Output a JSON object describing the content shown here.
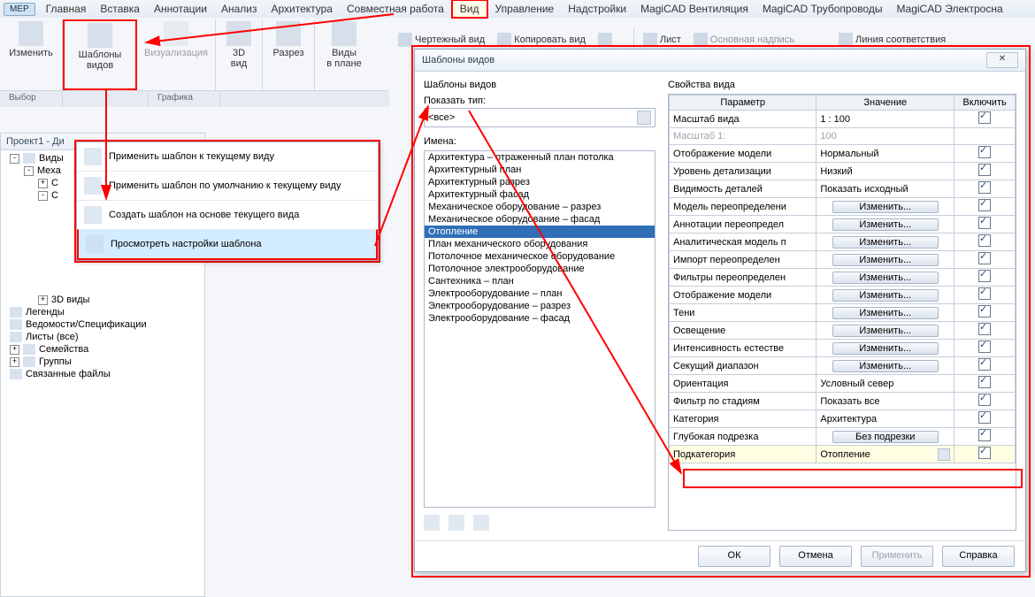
{
  "menu": {
    "mep": "МЕР",
    "items": [
      "Главная",
      "Вставка",
      "Аннотации",
      "Анализ",
      "Архитектура",
      "Совместная работа",
      "Вид",
      "Управление",
      "Надстройки",
      "MagiCAD Вентиляция",
      "MagiCAD Трубопроводы",
      "MagiCAD Электросна"
    ],
    "active": "Вид"
  },
  "subribbon": {
    "draftView": "Чертежный вид",
    "copyView": "Копировать вид",
    "sheet": "Лист",
    "titleBlock": "Основная надпись",
    "matchLine": "Линия соответствия"
  },
  "ribbon": {
    "edit": "Изменить",
    "templates": "Шаблоны\nвидов",
    "viz": "Визуализация",
    "view3d": "3D\nвид",
    "section": "Разрез",
    "planViews": "Виды\nв плане",
    "panelSelect": "Выбор",
    "panelGraphics": "Графика"
  },
  "browser": {
    "title": "Проект1 - Ди",
    "nodes": {
      "views": "Виды",
      "mech": "Mexa",
      "c": "С",
      "views3d": "3D виды",
      "legends": "Легенды",
      "schedules": "Ведомости/Спецификации",
      "sheets": "Листы (все)",
      "families": "Семейства",
      "groups": "Группы",
      "links": "Связанные файлы"
    }
  },
  "ctx": {
    "apply": "Применить шаблон к текущему виду",
    "applyDefault": "Применить шаблон по умолчанию к текущему виду",
    "create": "Создать шаблон на основе текущего вида",
    "view": "Просмотреть настройки шаблона"
  },
  "dlg": {
    "title": "Шаблоны видов",
    "left": {
      "heading": "Шаблоны видов",
      "showType": "Показать тип:",
      "all": "<все>",
      "names": "Имена:",
      "items": [
        "Архитектура – отраженный план потолка",
        "Архитектурный план",
        "Архитектурный разрез",
        "Архитектурный фасад",
        "Механическое оборудование – разрез",
        "Механическое оборудование – фасад",
        "Отопление",
        "План механического оборудования",
        "Потолочное механическое оборудование",
        "Потолочное электрооборудование",
        "Сантехника – план",
        "Электрооборудование – план",
        "Электрооборудование – разрез",
        "Электрооборудование – фасад"
      ],
      "selected": "Отопление"
    },
    "right": {
      "heading": "Свойства вида",
      "cols": {
        "param": "Параметр",
        "value": "Значение",
        "include": "Включить"
      },
      "rows": [
        {
          "p": "Масштаб вида",
          "v": "1 : 100",
          "btn": false,
          "inc": true
        },
        {
          "p": "Масштаб  1:",
          "v": "100",
          "btn": false,
          "inc": false,
          "dim": true
        },
        {
          "p": "Отображение модели",
          "v": "Нормальный",
          "btn": false,
          "inc": true
        },
        {
          "p": "Уровень детализации",
          "v": "Низкий",
          "btn": false,
          "inc": true
        },
        {
          "p": "Видимость деталей",
          "v": "Показать исходный",
          "btn": false,
          "inc": true
        },
        {
          "p": "Модель переопределени",
          "v": "Изменить...",
          "btn": true,
          "inc": true
        },
        {
          "p": "Аннотации переопредел",
          "v": "Изменить...",
          "btn": true,
          "inc": true
        },
        {
          "p": "Аналитическая модель п",
          "v": "Изменить...",
          "btn": true,
          "inc": true
        },
        {
          "p": "Импорт переопределен",
          "v": "Изменить...",
          "btn": true,
          "inc": true
        },
        {
          "p": "Фильтры переопределен",
          "v": "Изменить...",
          "btn": true,
          "inc": true
        },
        {
          "p": "Отображение модели",
          "v": "Изменить...",
          "btn": true,
          "inc": true
        },
        {
          "p": "Тени",
          "v": "Изменить...",
          "btn": true,
          "inc": true
        },
        {
          "p": "Освещение",
          "v": "Изменить...",
          "btn": true,
          "inc": true
        },
        {
          "p": "Интенсивность естестве",
          "v": "Изменить...",
          "btn": true,
          "inc": true
        },
        {
          "p": "Секущий диапазон",
          "v": "Изменить...",
          "btn": true,
          "inc": true
        },
        {
          "p": "Ориентация",
          "v": "Условный север",
          "btn": false,
          "inc": true
        },
        {
          "p": "Фильтр по стадиям",
          "v": "Показать все",
          "btn": false,
          "inc": true
        },
        {
          "p": "Категория",
          "v": "Архитектура",
          "btn": false,
          "inc": true
        },
        {
          "p": "Глубокая подрезка",
          "v": "Без подрезки",
          "btn": true,
          "inc": true
        },
        {
          "p": "Подкатегория",
          "v": "Отопление",
          "btn": false,
          "inc": true,
          "combo": true,
          "hl": true
        }
      ]
    },
    "buttons": {
      "ok": "ОК",
      "cancel": "Отмена",
      "apply": "Применить",
      "help": "Справка"
    }
  }
}
